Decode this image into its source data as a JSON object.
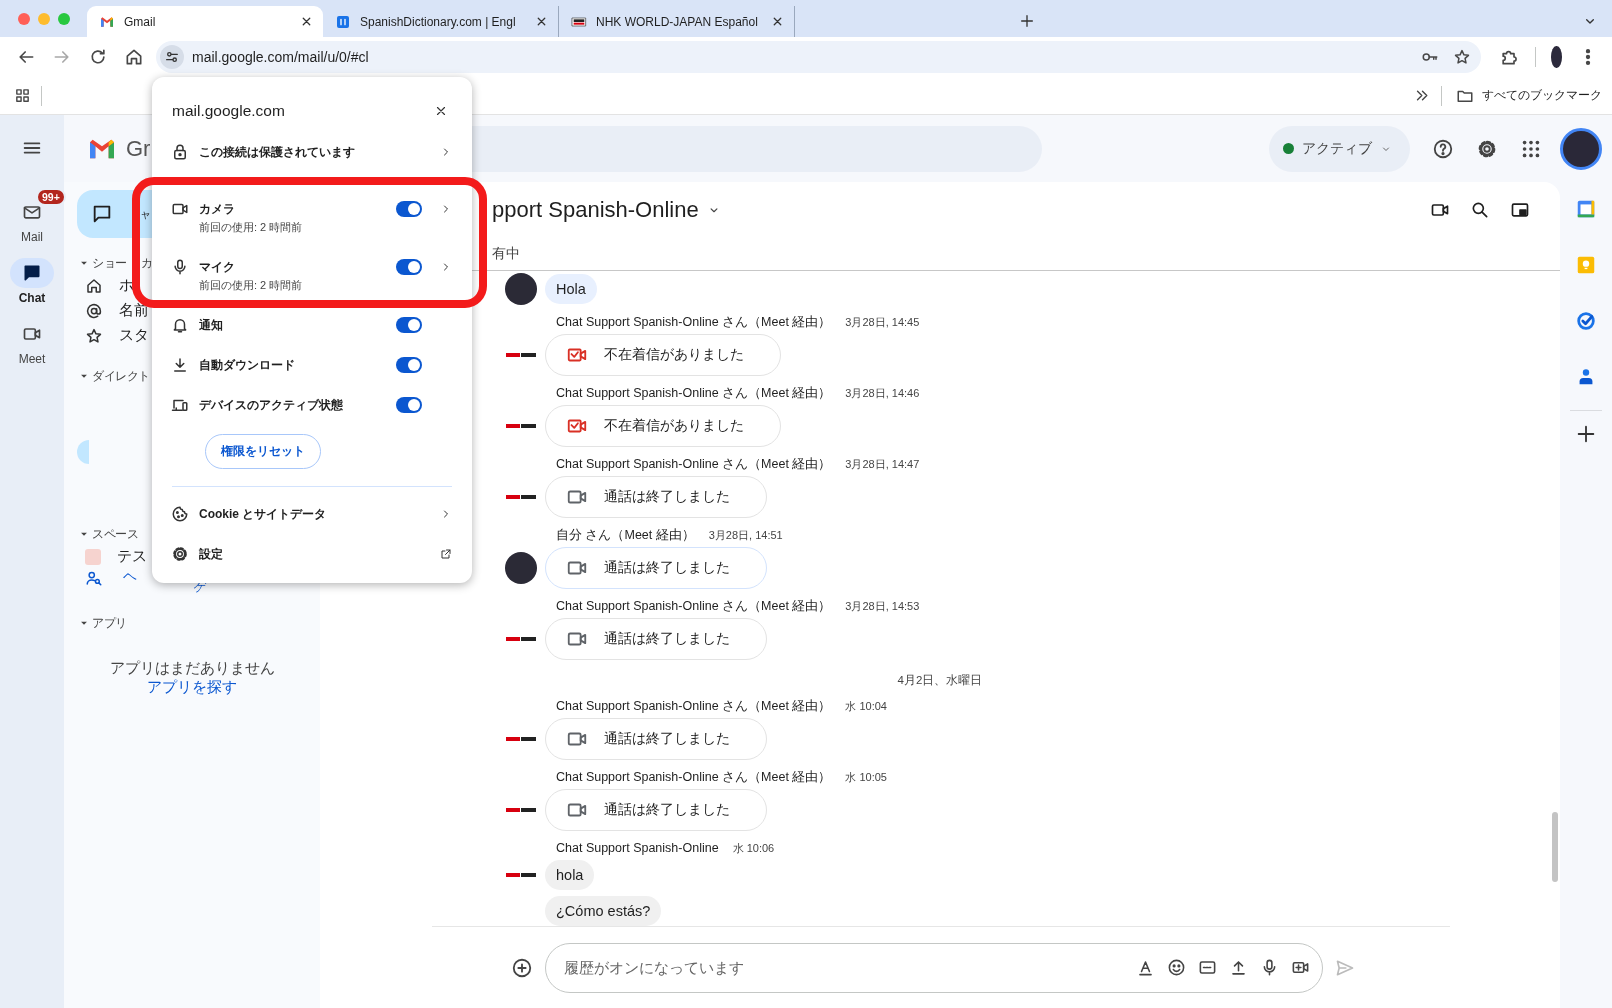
{
  "browser": {
    "tabs": [
      {
        "title": "Gmail",
        "selected": true
      },
      {
        "title": "SpanishDictionary.com | Engl",
        "selected": false
      },
      {
        "title": "NHK WORLD-JAPAN Español",
        "selected": false
      }
    ],
    "address": "mail.google.com/mail/u/0/#cl",
    "all_bookmarks": "すべてのブックマーク"
  },
  "site_popup": {
    "title": "mail.google.com",
    "connection": "この接続は保護されています",
    "permissions": [
      {
        "label": "カメラ",
        "detail": "前回の使用: 2 時間前",
        "on": true,
        "chevron": true
      },
      {
        "label": "マイク",
        "detail": "前回の使用: 2 時間前",
        "on": true,
        "chevron": true
      },
      {
        "label": "通知",
        "on": true,
        "chevron": false
      },
      {
        "label": "自動ダウンロード",
        "on": true,
        "chevron": false
      },
      {
        "label": "デバイスのアクティブ状態",
        "on": true,
        "chevron": false
      }
    ],
    "reset_button": "権限をリセット",
    "links": [
      {
        "label": "Cookie とサイトデータ",
        "kind": "submenu"
      },
      {
        "label": "設定",
        "kind": "external"
      }
    ]
  },
  "gmail": {
    "logo_text": "Gr",
    "status": "アクティブ",
    "rail": [
      {
        "label": "Mail",
        "badge": "99+",
        "selected": false
      },
      {
        "label": "Chat",
        "selected": true
      },
      {
        "label": "Meet",
        "selected": false
      }
    ],
    "nav": {
      "new_chat": "ャ",
      "shortcuts_heading": "ショー",
      "shortcuts_heading_tail": "カ",
      "shortcuts": [
        "ホ",
        "名前",
        "スタ"
      ],
      "direct_heading": "ダイレクト",
      "spaces_heading": "スペース",
      "space_item": "テス",
      "space_fragment_1": "ヘ",
      "space_fragment_2": "ゲ",
      "apps_heading": "アプリ",
      "apps_empty": "アプリはまだありません",
      "apps_link": "アプリを探す"
    }
  },
  "chat": {
    "title": "pport Spanish-Online",
    "tab": "有中",
    "messages": [
      {
        "kind": "text",
        "own": true,
        "texts": [
          "Hola"
        ]
      },
      {
        "kind": "missed_call",
        "own": false,
        "sender": "Chat Support Spanish-Online さん（Meet 経由）",
        "time": "3月28日, 14:45",
        "label": "不在着信がありました"
      },
      {
        "kind": "missed_call",
        "own": false,
        "sender": "Chat Support Spanish-Online さん（Meet 経由）",
        "time": "3月28日, 14:46",
        "label": "不在着信がありました"
      },
      {
        "kind": "ended_call",
        "own": false,
        "sender": "Chat Support Spanish-Online さん（Meet 経由）",
        "time": "3月28日, 14:47",
        "label": "通話は終了しました"
      },
      {
        "kind": "ended_call",
        "own": true,
        "sender": "自分 さん（Meet 経由）",
        "time": "3月28日, 14:51",
        "label": "通話は終了しました"
      },
      {
        "kind": "ended_call",
        "own": false,
        "sender": "Chat Support Spanish-Online さん（Meet 経由）",
        "time": "3月28日, 14:53",
        "label": "通話は終了しました"
      },
      {
        "kind": "date",
        "label": "4月2日、水曜日"
      },
      {
        "kind": "ended_call",
        "own": false,
        "sender": "Chat Support Spanish-Online さん（Meet 経由）",
        "time": "水 10:04",
        "label": "通話は終了しました"
      },
      {
        "kind": "ended_call",
        "own": false,
        "sender": "Chat Support Spanish-Online さん（Meet 経由）",
        "time": "水 10:05",
        "label": "通話は終了しました"
      },
      {
        "kind": "text",
        "own": false,
        "sender": "Chat Support Spanish-Online",
        "time": "水 10:06",
        "texts": [
          "hola",
          "¿Cómo estás?"
        ]
      }
    ],
    "composer": {
      "placeholder": "履歴がオンになっています"
    }
  }
}
